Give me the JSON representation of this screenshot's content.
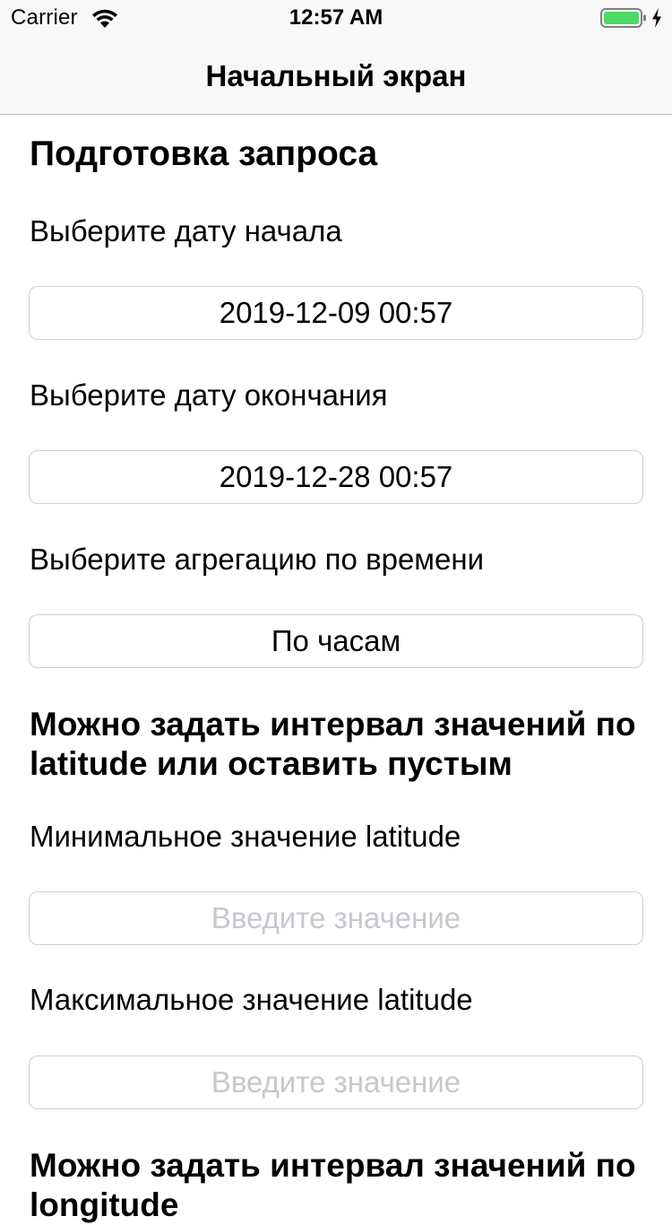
{
  "status_bar": {
    "carrier": "Carrier",
    "time": "12:57 AM",
    "battery_color": "#4cd964"
  },
  "nav": {
    "title": "Начальный экран"
  },
  "form": {
    "section_title": "Подготовка запроса",
    "start_date": {
      "label": "Выберите дату начала",
      "value": "2019-12-09 00:57"
    },
    "end_date": {
      "label": "Выберите дату окончания",
      "value": "2019-12-28 00:57"
    },
    "aggregation": {
      "label": "Выберите агрегацию по времени",
      "value": "По часам"
    },
    "latitude_section": {
      "title": "Можно задать интервал значений по latitude или оставить пустым",
      "min_label": "Минимальное значение latitude",
      "min_placeholder": "Введите значение",
      "max_label": "Максимальное значение latitude",
      "max_placeholder": "Введите значение"
    },
    "longitude_section": {
      "title": "Можно задать интервал значений по longitude"
    }
  }
}
